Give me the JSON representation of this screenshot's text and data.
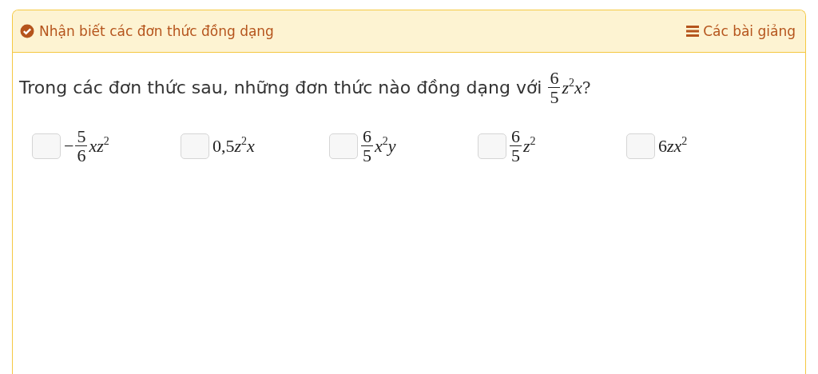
{
  "header": {
    "title": "Nhận biết các đơn thức đồng dạng",
    "link": "Các bài giảng"
  },
  "question": {
    "text": "Trong các đơn thức sau, những đơn thức nào đồng dạng với",
    "fraction": {
      "numerator": "6",
      "denominator": "5"
    },
    "expression": "z$^{2}$x",
    "suffix": "?"
  },
  "options": [
    {
      "checked": false,
      "sign": "−",
      "fraction": {
        "numerator": "5",
        "denominator": "6"
      },
      "expression": "xz$^{2}$"
    },
    {
      "checked": false,
      "coefficient": "0,5",
      "expression": "z$^{2}$x"
    },
    {
      "checked": false,
      "fraction": {
        "numerator": "6",
        "denominator": "5"
      },
      "expression": "x$^{2}$y"
    },
    {
      "checked": false,
      "fraction": {
        "numerator": "6",
        "denominator": "5"
      },
      "expression": "z$^{2}$"
    },
    {
      "checked": false,
      "coefficient": "6",
      "expression": "zx$^{2}$"
    }
  ]
}
